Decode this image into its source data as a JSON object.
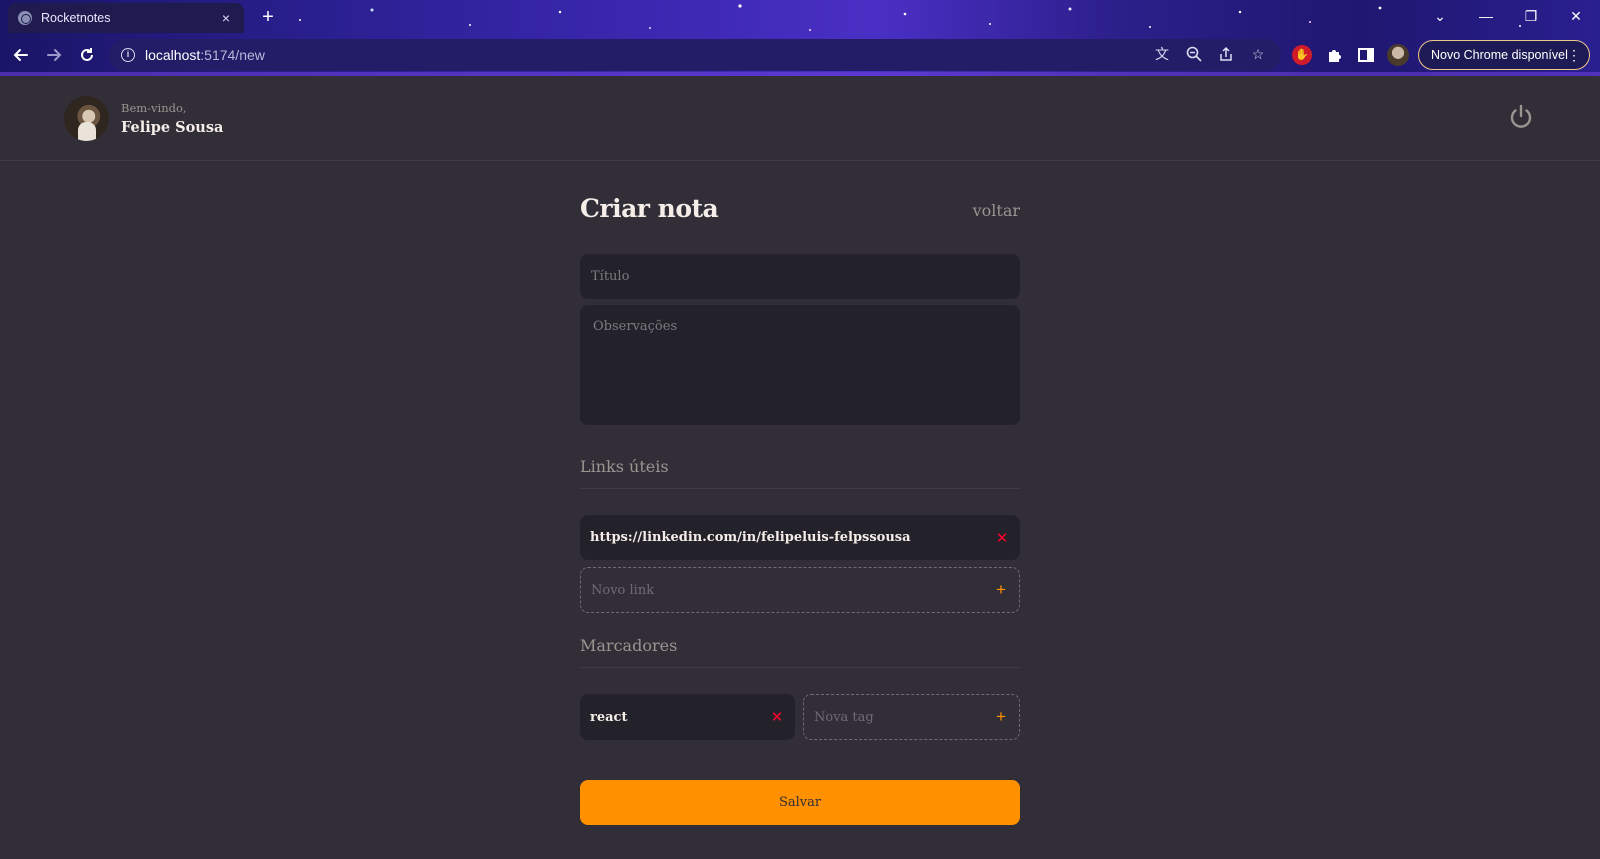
{
  "browser": {
    "tab_title": "Rocketnotes",
    "tab_close_icon": "×",
    "new_tab_icon": "+",
    "url_host": "localhost",
    "url_path": ":5174/new",
    "update_label": "Novo Chrome disponível",
    "window_controls": {
      "minimize": "—",
      "restore": "❐",
      "close": "✕",
      "tabsearch": "⌄"
    }
  },
  "header": {
    "welcome": "Bem-vindo,",
    "username": "Felipe Sousa"
  },
  "page": {
    "title": "Criar nota",
    "back_label": "voltar",
    "title_placeholder": "Título",
    "obs_placeholder": "Observações"
  },
  "links": {
    "section_title": "Links úteis",
    "items": [
      "https://linkedin.com/in/felipeluis-felpssousa"
    ],
    "new_placeholder": "Novo link"
  },
  "tags": {
    "section_title": "Marcadores",
    "items": [
      "react"
    ],
    "new_placeholder": "Nova tag"
  },
  "actions": {
    "save_label": "Salvar"
  },
  "colors": {
    "background": "#312E38",
    "input_bg": "#232129",
    "accent": "#FF9000",
    "danger": "#FF002E",
    "text": "#F4EDE8",
    "muted": "#999591"
  }
}
